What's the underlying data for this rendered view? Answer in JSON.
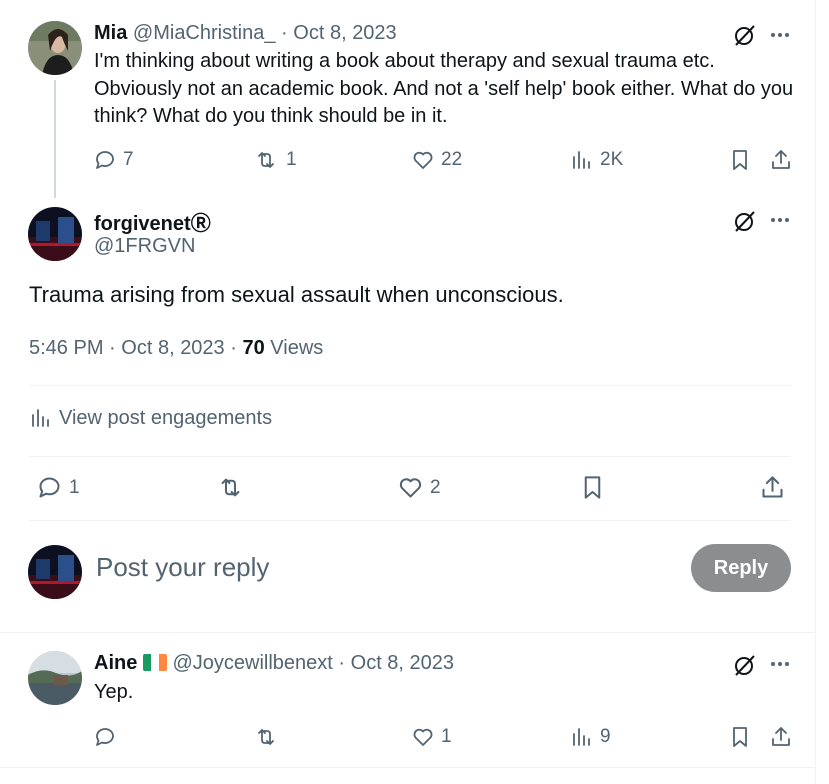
{
  "parent_tweet": {
    "name": "Mia",
    "handle": "@MiaChristina_",
    "date": "Oct 8, 2023",
    "text": "I'm thinking about writing a book about therapy and sexual trauma etc. Obviously not an academic book. And not a 'self help' book either. What do you think? What do you think should be in it.",
    "replies": "7",
    "reposts": "1",
    "likes": "22",
    "views": "2K"
  },
  "main_tweet": {
    "name": "forgivenet",
    "name_badge": "Ⓡ",
    "handle": "@1FRGVN",
    "text": "Trauma arising from sexual assault when unconscious.",
    "time": "5:46 PM",
    "date": "Oct 8, 2023",
    "views_count": "70",
    "views_label": "Views",
    "engagements_label": "View post engagements",
    "replies": "1",
    "likes": "2"
  },
  "composer": {
    "placeholder": "Post your reply",
    "reply_label": "Reply"
  },
  "reply_tweet": {
    "name": "Aine",
    "flag": "🇮🇪",
    "handle": "@Joycewillbenext",
    "date": "Oct 8, 2023",
    "text": "Yep.",
    "likes": "1",
    "views": "9"
  },
  "separator": "·",
  "colors": {
    "text": "#0f1419",
    "muted": "#536471",
    "divider": "#eff3f4",
    "reply_button": "#8b8d8f"
  },
  "icons": [
    "reply-icon",
    "repost-icon",
    "like-icon",
    "views-icon",
    "bookmark-icon",
    "share-icon",
    "grok-icon",
    "more-icon"
  ]
}
